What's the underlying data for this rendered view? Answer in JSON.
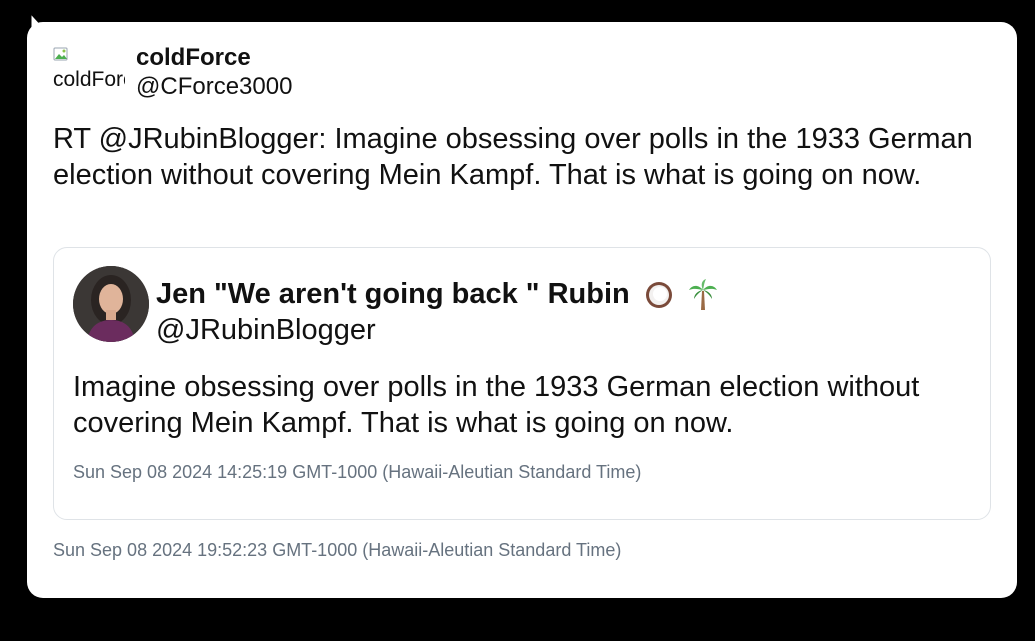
{
  "tweet": {
    "author": {
      "name": "coldForce",
      "handle": "@CForce3000",
      "avatar_alt": "coldForce"
    },
    "text": "RT @JRubinBlogger: Imagine obsessing over polls in the 1933 German election without covering Mein Kampf. That is what is going on now.",
    "timestamp": "Sun Sep 08 2024 19:52:23 GMT-1000 (Hawaii-Aleutian Standard Time)",
    "quoted": {
      "name": "Jen \"We aren't going back \" Rubin",
      "handle": "@JRubinBlogger",
      "text": "Imagine obsessing over polls in the 1933 German election without covering Mein Kampf. That is what is going on now.",
      "timestamp": "Sun Sep 08 2024 14:25:19 GMT-1000 (Hawaii-Aleutian Standard Time)",
      "emojis": [
        "coconut-icon",
        "palm-tree-icon"
      ]
    }
  }
}
